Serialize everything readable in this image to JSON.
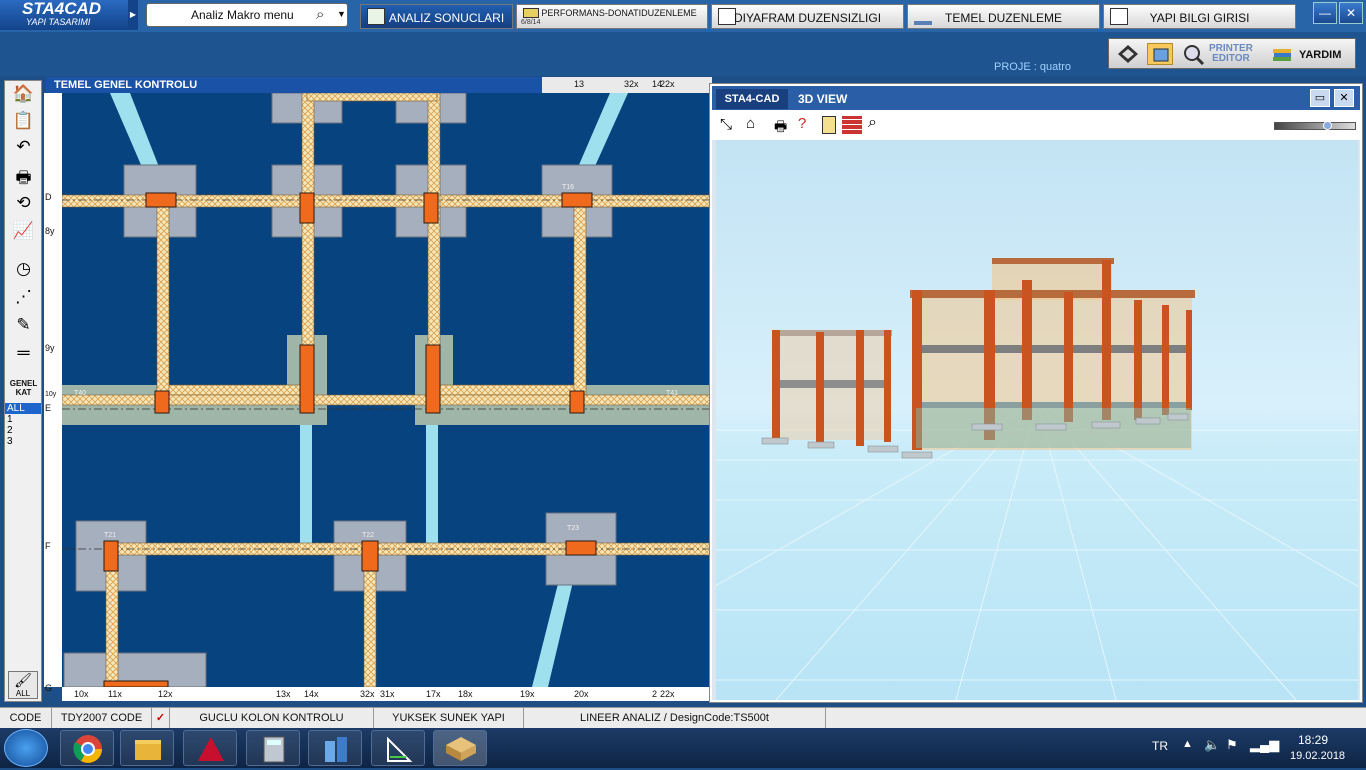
{
  "app": {
    "logo_line1": "STA4CAD",
    "logo_line2": "YAPI TASARIMI"
  },
  "macro": {
    "label": "Analiz Makro menu"
  },
  "tabs": {
    "analiz": "ANALIZ SONUCLARI",
    "performans": "PERFORMANS-DONATIDUZENLEME",
    "performans_sub": "6/8/14",
    "diyafram": "DIYAFRAM DUZENSIZLIGI",
    "temel": "TEMEL DUZENLEME",
    "yapi": "YAPI BILGI GIRISI"
  },
  "toolbar_right": {
    "printer_line1": "PRINTER",
    "printer_line2": "EDITOR",
    "help": "YARDIM"
  },
  "project": "PROJE : quatro",
  "left_panel": {
    "genel_line1": "GENEL",
    "genel_line2": "KAT",
    "floors": [
      "ALL",
      "1",
      "2",
      "3"
    ],
    "selected": "ALL",
    "all_button": "ALL"
  },
  "plan": {
    "title": "TEMEL GENEL KONTROLU",
    "top_ruler": [
      "13",
      "32x",
      "14",
      "22x"
    ],
    "left_labels": [
      "D",
      "8y",
      "9y",
      "10y",
      "E",
      "F",
      "G"
    ],
    "bottom_labels": [
      "10x",
      "11x",
      "12x",
      "13x",
      "14x",
      "32x",
      "31x",
      "17x",
      "18x",
      "19x",
      "20x",
      "2",
      "22x"
    ],
    "footing_labels": [
      "T40",
      "T41",
      "T21",
      "T22",
      "T23",
      "T16"
    ]
  },
  "view3d": {
    "tab1": "STA4-CAD",
    "tab2": "3D VIEW"
  },
  "status": {
    "code": "CODE",
    "tdy": "TDY2007 CODE",
    "guclu": "GUCLU KOLON KONTROLU",
    "yuksek": "YUKSEK SUNEK YAPI",
    "lineer": "LINEER ANALIZ / DesignCode:TS500t"
  },
  "tray": {
    "lang": "TR",
    "time": "18:29",
    "date": "19.02.2018"
  }
}
